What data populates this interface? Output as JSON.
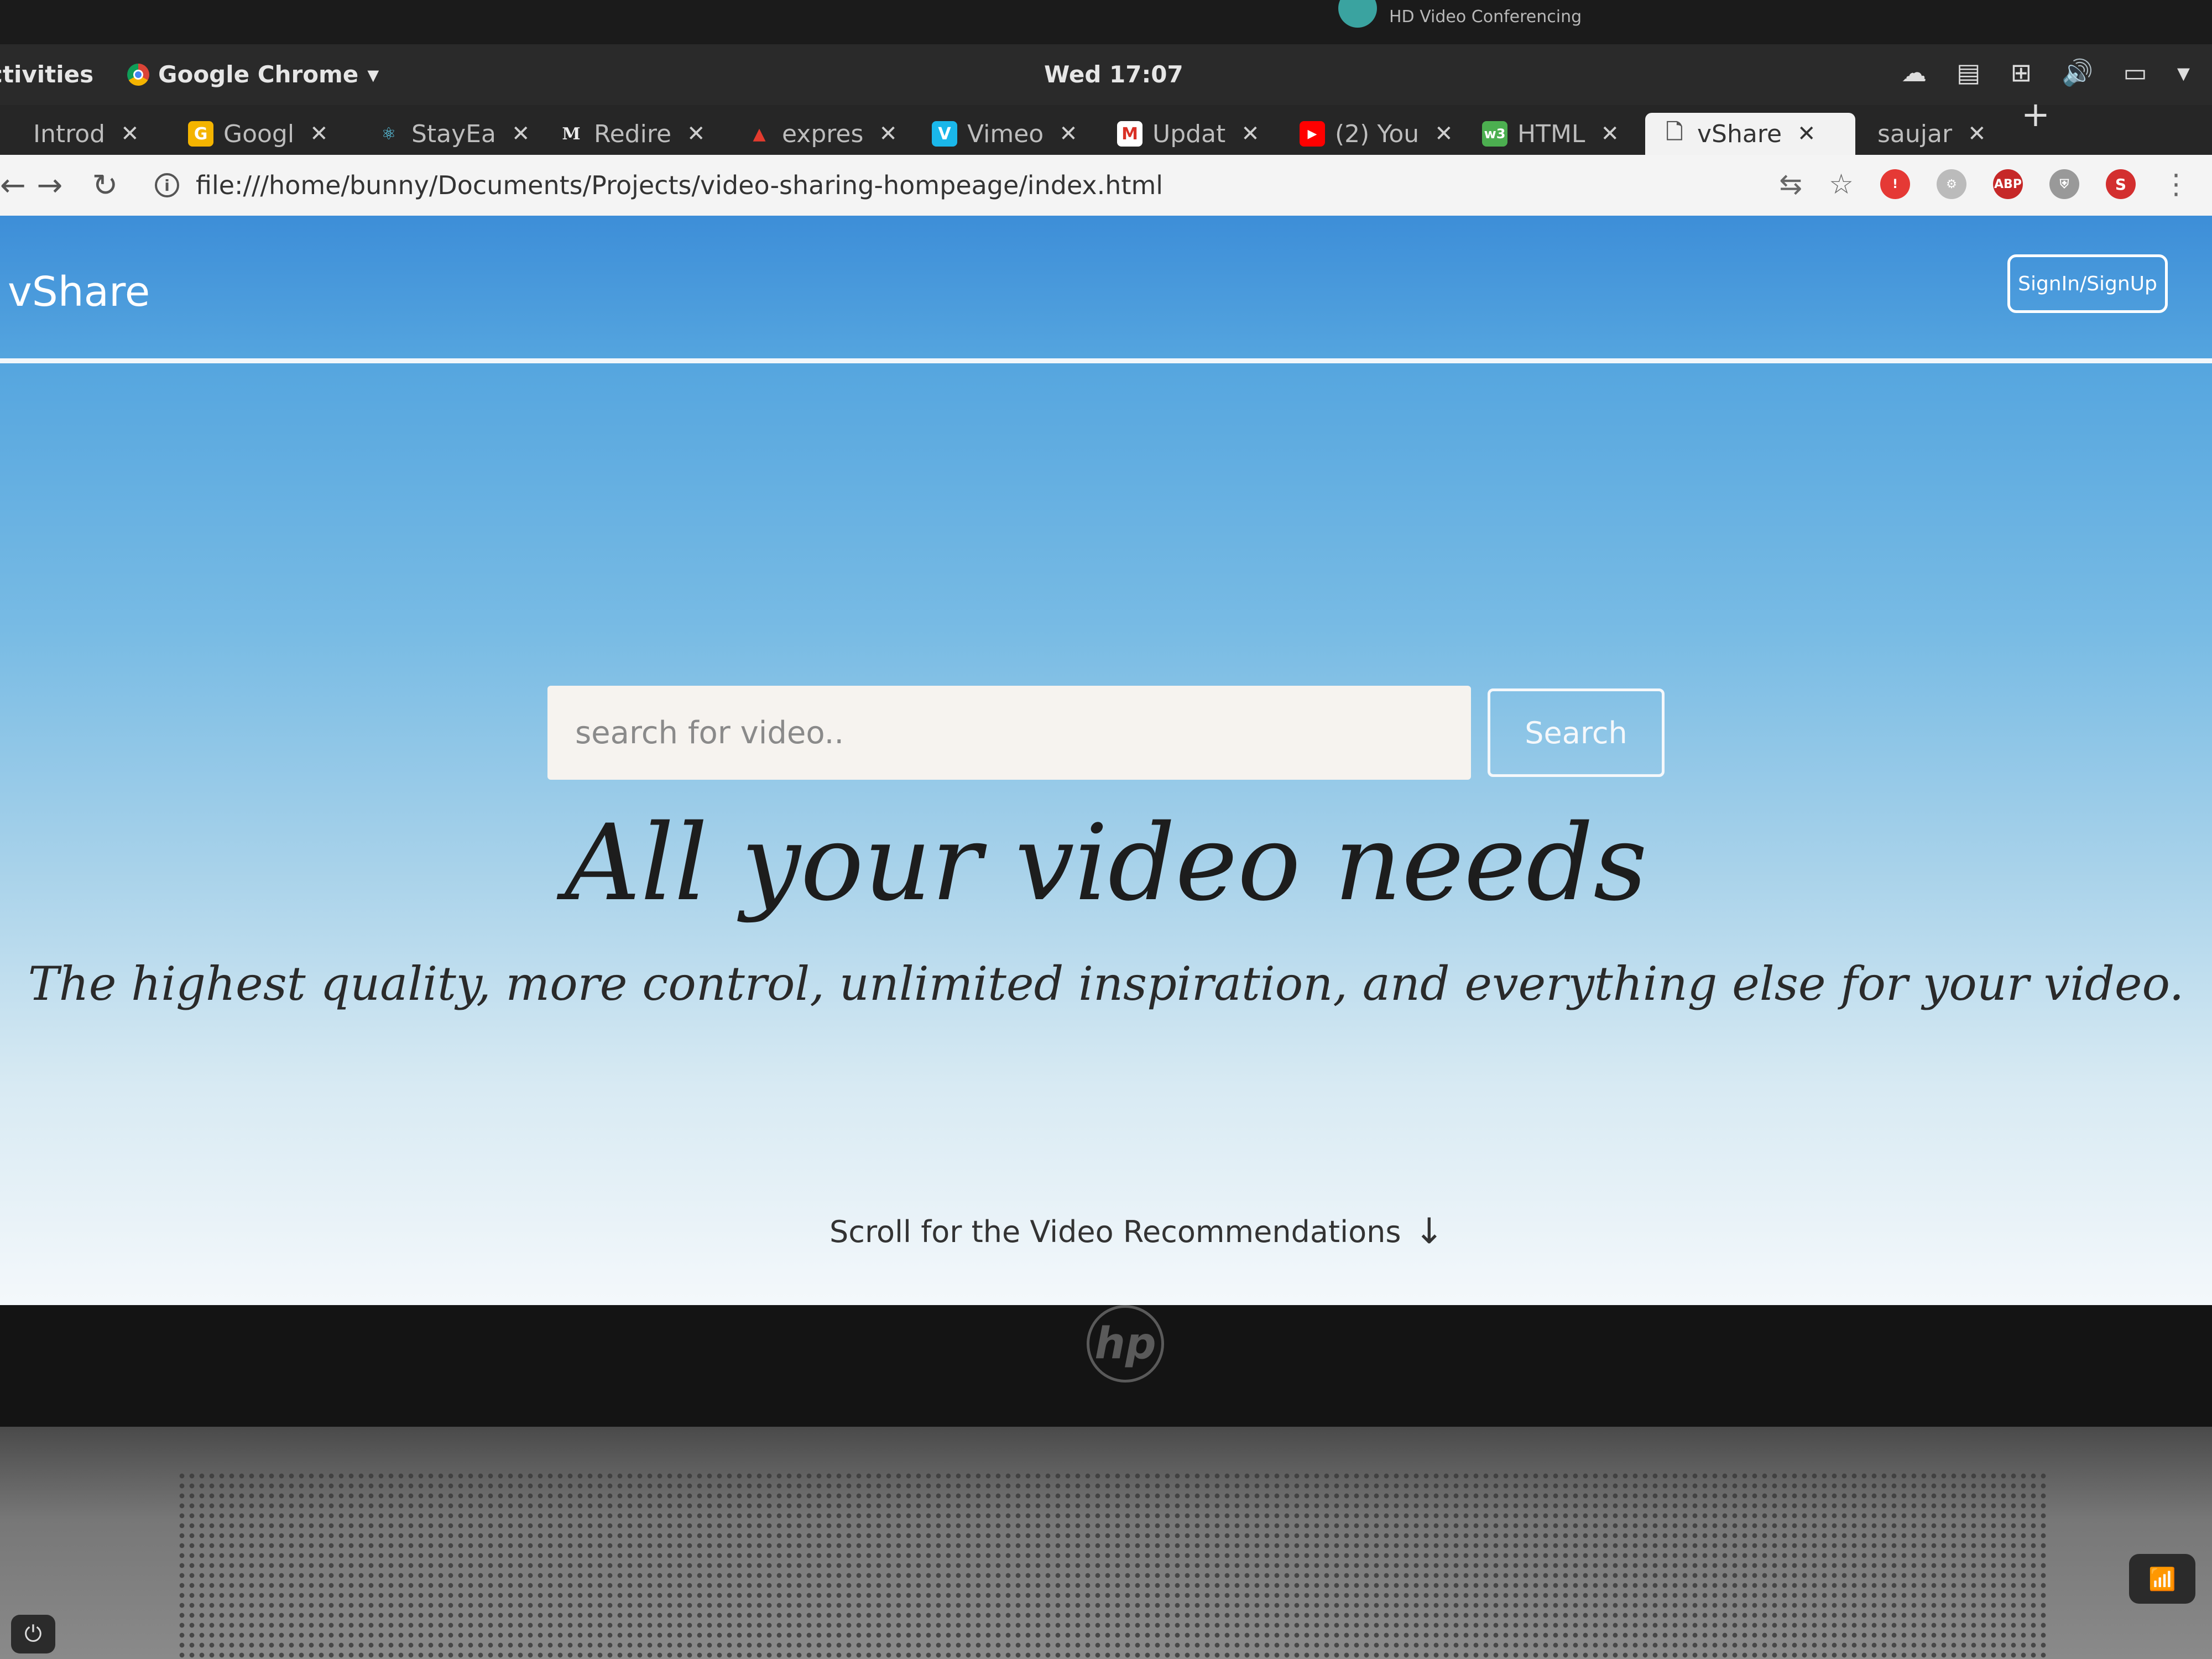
{
  "system": {
    "notification_text": "HD Video Conferencing",
    "activities_label": "ctivities",
    "app_menu_label": "Google Chrome",
    "clock": "Wed 17:07"
  },
  "tabs": [
    {
      "label": "Introd",
      "icon": "page-icon",
      "color": "#3a3a3a"
    },
    {
      "label": "Googl",
      "icon": "google-icon",
      "color": "#f4b400"
    },
    {
      "label": "StayEa",
      "icon": "react-icon",
      "color": "#61dafb"
    },
    {
      "label": "Redire",
      "icon": "medium-icon",
      "color": "#222222"
    },
    {
      "label": "expres",
      "icon": "express-icon",
      "color": "#e33b2e"
    },
    {
      "label": "Vimeo",
      "icon": "vimeo-icon",
      "color": "#1ab7ea"
    },
    {
      "label": "Updat",
      "icon": "gmail-icon",
      "color": "#d93025"
    },
    {
      "label": "(2) You",
      "icon": "youtube-icon",
      "color": "#ff0000"
    },
    {
      "label": "HTML",
      "icon": "w3-icon",
      "color": "#4caf50"
    },
    {
      "label": "vShare",
      "icon": "document-icon",
      "color": "#ffffff"
    },
    {
      "label": "saujar",
      "icon": "none",
      "color": "#262626"
    }
  ],
  "address_bar": {
    "url": "file:///home/bunny/Documents/Projects/video-sharing-hompeage/index.html"
  },
  "page": {
    "brand": "vShare",
    "signin_label": "SignIn/SignUp",
    "search_placeholder": "search for video..",
    "search_button": "Search",
    "headline": "All your video needs",
    "tagline": "The highest quality, more control, unlimited inspiration, and everything else for your video.",
    "scroll_hint": "Scroll for the Video Recommendations"
  },
  "laptop": {
    "logo_text": "hp"
  },
  "colors": {
    "page_gradient_top": "#3d8ed8",
    "page_gradient_bottom": "#f4f8fb",
    "accent_white": "#ffffff"
  }
}
